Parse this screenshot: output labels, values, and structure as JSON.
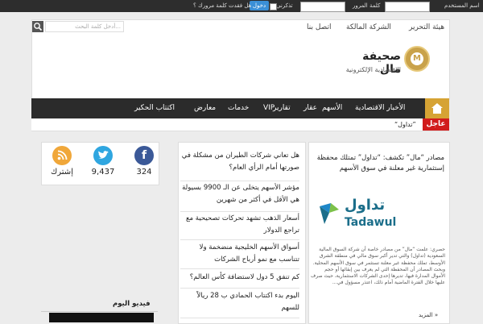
{
  "topbar": {
    "username_label": "اسم المستخدم",
    "password_label": "كلمة المرور",
    "remember_label": "تذكرني",
    "login_button": "دخول",
    "forgot_label": "هل فقدت كلمة مرورك ؟"
  },
  "header": {
    "search_placeholder": "أدخل كلمة البحث...",
    "links": [
      "هيئة التحرير",
      "الشركة المالكة",
      "اتصل بنا"
    ],
    "logo_title": "صحيفة مال",
    "logo_subtitle": "الاقتصادية الإلكترونية",
    "logo_monogram": "M"
  },
  "nav": {
    "items": [
      "الأخبار الاقتصادية",
      "الأسهم",
      "عقار",
      "تقارير",
      "VIP",
      "خدمات",
      "معارض",
      "اكتتاب الحكير"
    ],
    "breaking_label": "عاجل",
    "ticker_text": "“تداول”"
  },
  "lead": {
    "title": "مصادر “مال” تكشف: “تداول” تمتلك محفظة إستثمارية غير معلنة في سوق الأسهم",
    "logo_ar": "تداول",
    "logo_en": "Tadawul",
    "body": "حصري: علمت “مال” من مصادر خاصة أن شركة السوق المالية السعودية (تداول) والتي تدير أكبر سوق مالي في منطقة الشرق الأوسط، تملك محفظة غير معلنة تستثمر في سوق الأسهم المحلية. وبحث المصادر أن المحفظة التي لم يعرف بين إبقائها أو حجم الأموال المدارة فيها، تديرها إحدى الشركات الاستثمارية، حيث صرف عليها خلال الفترة الماضية أمام ذلك، اعتذر مسؤول في...",
    "read_more": "المزيد »"
  },
  "mid_list": [
    "هل تعاني شركات الطيران من مشكلة في صورتها أمام الرأي العام؟",
    "مؤشر الأسهم يتخلى عن الـ 9900 بسيولة هي الأقل في أكثر من شهرين",
    "أسعار الذهب تشهد تحركات تصحيحية مع تراجع الدولار ￼￼",
    "أسواق الأسهم الخليجية منضخمة ولا تتناسب مع نمو أرباح الشركات",
    "كم تنفق 5 دول لاستضافة كأس العالم؟ ￼￼",
    "اليوم ￼￼بدء اكتتاب ￼الحمادي￼ ب 28 ريالاً للسهم"
  ],
  "social": {
    "items": [
      {
        "name": "facebook",
        "count": "324",
        "color": "#3b5998"
      },
      {
        "name": "twitter",
        "count": "9,437",
        "color": "#2fa6e0"
      },
      {
        "name": "rss",
        "count": "إشترك",
        "color": "#f0a73a"
      }
    ]
  },
  "video": {
    "title": "فيديو اليوم"
  },
  "colors": {
    "accent": "#d6a334",
    "breaking": "#d11c1c",
    "nav_bg": "#2b2b2b"
  }
}
